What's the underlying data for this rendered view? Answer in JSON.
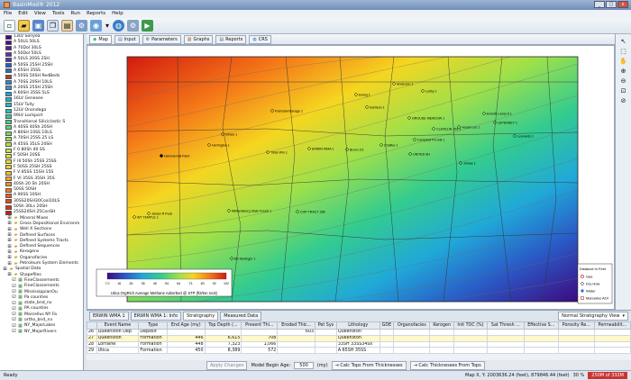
{
  "window": {
    "title": "BasinMod® 2012",
    "controls": [
      "_",
      "□",
      "x"
    ]
  },
  "menu": [
    "File",
    "Edit",
    "View",
    "Tools",
    "Run",
    "Reports",
    "Help"
  ],
  "toolbar": {
    "icons": [
      "new-icon",
      "open-icon",
      "save-icon",
      "copy-icon",
      "paste-icon",
      "settings-icon",
      "map-icon",
      "chevron-down-icon",
      "globe-icon",
      "gear-icon",
      "play-icon"
    ]
  },
  "layers": [
    {
      "label": "13LV Sonyea",
      "color": "#4b0082"
    },
    {
      "label": "A 50LS 50LS",
      "color": "#4d0c8f"
    },
    {
      "label": "A 70Dol 30LS",
      "color": "#5b1aa0"
    },
    {
      "label": "A 50Dol 50LS",
      "color": "#6a2eb5"
    },
    {
      "label": "A 50LS 20SS 2SH",
      "color": "#3b3fb8"
    },
    {
      "label": "A 50SS 25SH 25SH",
      "color": "#2b5ac6"
    },
    {
      "label": "A 65SH 35SS",
      "color": "#2070cf"
    },
    {
      "label": "A 50SS 50SH RedBeds",
      "color": "#b0402a"
    },
    {
      "label": "A 70SS 20SH 10LS",
      "color": "#2a87d4"
    },
    {
      "label": "A 20SS 25SH 25SH",
      "color": "#2b96d8"
    },
    {
      "label": "A 60SH 35SS 5LS",
      "color": "#1fa5dc"
    },
    {
      "label": "16LV Genesee",
      "color": "#19b2d8"
    },
    {
      "label": "15LV Tully",
      "color": "#19bdcc"
    },
    {
      "label": "12LV Onondaga",
      "color": "#1ec6b8"
    },
    {
      "label": "09LV Lockport",
      "color": "#2ccda0"
    },
    {
      "label": "Transitional Siliciclastic S",
      "color": "#40d28a"
    },
    {
      "label": "A 40SS 40Sh 20SH",
      "color": "#5cd676"
    },
    {
      "label": "A 80SH 10SS 10LS",
      "color": "#78da62"
    },
    {
      "label": "A 70SH 25SS 25 LS",
      "color": "#96de50"
    },
    {
      "label": "A 45SS 35LS 20SH",
      "color": "#b1e040"
    },
    {
      "label": "F 0 80Sh 40 SS",
      "color": "#c9e234"
    },
    {
      "label": "F 50SH 20SS",
      "color": "#dde22c"
    },
    {
      "label": "F III 50Sh 25SS 25SS",
      "color": "#eddc26"
    },
    {
      "label": "F 50SS 25SH 25SS",
      "color": "#f6cf22"
    },
    {
      "label": "F V 85SS 15SH 15S",
      "color": "#f9bd20"
    },
    {
      "label": "F VI 35SS 35SH 35S",
      "color": "#fba61e"
    },
    {
      "label": "40Sh 20 Sh 20SH",
      "color": "#fc8e1c"
    },
    {
      "label": "50SS 50SH",
      "color": "#fc751a"
    },
    {
      "label": "A 90SS 10SH",
      "color": "#f85c18"
    },
    {
      "label": "30SS20SH30Coal10LS",
      "color": "#f04416"
    },
    {
      "label": "50Sh 30Ls 20SH",
      "color": "#e02f14"
    },
    {
      "label": "25SS20SH 25ConSH",
      "color": "#c81e12"
    }
  ],
  "tree": [
    {
      "label": "Mineral Mixes",
      "icon": "folder-icon",
      "indent": 1
    },
    {
      "label": "Gross Depositional Environm",
      "icon": "folder-icon",
      "indent": 1
    },
    {
      "label": "Well X Sections",
      "icon": "folder-icon",
      "indent": 1
    },
    {
      "label": "Defined Surfaces",
      "icon": "folder-icon",
      "indent": 1
    },
    {
      "label": "Defined Systems Tracts",
      "icon": "folder-icon",
      "indent": 1
    },
    {
      "label": "Defined Sequences",
      "icon": "folder-icon",
      "indent": 1
    },
    {
      "label": "Kerogens",
      "icon": "folder-icon",
      "indent": 1
    },
    {
      "label": "Organofacies",
      "icon": "folder-icon",
      "indent": 1
    },
    {
      "label": "Petroleum System Elements",
      "icon": "folder-icon",
      "indent": 1
    },
    {
      "label": "Spatial Data",
      "icon": "folder-icon",
      "indent": 0
    },
    {
      "label": "Shapefiles",
      "icon": "folder-icon",
      "indent": 1
    },
    {
      "label": "FineClassements",
      "icon": "layer-icon",
      "indent": 2
    },
    {
      "label": "FineClassements",
      "icon": "layer-icon",
      "indent": 2
    },
    {
      "label": "MississippianOu",
      "icon": "layer-icon",
      "indent": 2
    },
    {
      "label": "Pa counties",
      "icon": "layer-icon",
      "indent": 2
    },
    {
      "label": "state_bnd_nv",
      "icon": "layer-icon",
      "indent": 2
    },
    {
      "label": "PA counties",
      "icon": "layer-icon",
      "indent": 2
    },
    {
      "label": "Marcellus NY Fa",
      "icon": "layer-icon",
      "indent": 2
    },
    {
      "label": "ortho_bnd_nv",
      "icon": "layer-icon",
      "indent": 2
    },
    {
      "label": "NY_MajorLakes",
      "icon": "layer-icon",
      "indent": 2
    },
    {
      "label": "NY_MajorRivers",
      "icon": "layer-icon",
      "indent": 2
    }
  ],
  "tabs": [
    {
      "label": "Map",
      "icon": "map-icon",
      "active": true
    },
    {
      "label": "Input",
      "icon": "input-icon",
      "active": false
    },
    {
      "label": "Parameters",
      "icon": "gear-icon",
      "active": false
    },
    {
      "label": "Graphs",
      "icon": "chart-icon",
      "active": false
    },
    {
      "label": "Reports",
      "icon": "report-icon",
      "active": false
    },
    {
      "label": "CRS",
      "icon": "globe-icon",
      "active": false
    }
  ],
  "map": {
    "wells": [
      {
        "label": "Hammermill Paint"
      },
      {
        "label": "Herrington 1"
      },
      {
        "label": "Dinele 1"
      },
      {
        "label": "Framsdw/Savage 1"
      },
      {
        "label": "Darrison 1"
      },
      {
        "label": "Ewing 1"
      },
      {
        "label": "Anderson 1"
      },
      {
        "label": "Lebby 1"
      },
      {
        "label": "GROUSE MEADOW 1"
      },
      {
        "label": "CLEVELIN 153 1"
      },
      {
        "label": "Hoose Lee 1"
      },
      {
        "label": "Emmitt Lowry 6 1"
      },
      {
        "label": "Tibbs Wln 1"
      },
      {
        "label": "Brenn 2/1"
      },
      {
        "label": "ERWIN WMA 1"
      },
      {
        "label": "Chaffee 1"
      },
      {
        "label": "Campbell Pd unit 1"
      },
      {
        "label": "LEPENSEY 1"
      },
      {
        "label": "UNITED 8H"
      },
      {
        "label": "James R Peck"
      },
      {
        "label": "WT TEMPLE 1"
      },
      {
        "label": "Williamsburg State Forest 1"
      },
      {
        "label": "COP TRACT 285"
      },
      {
        "label": "Jomee 1"
      },
      {
        "label": "Elb Bevinger 1"
      },
      {
        "label": "Leonards 1"
      }
    ],
    "colorbar": {
      "ticks": [
        "7.0",
        "16",
        "26",
        "35",
        "45",
        "54",
        "64",
        "73",
        "83",
        "92",
        "102"
      ],
      "caption": "Utica OrgRich Average Methane Adsorbed @ STP (ft3/ton rock)"
    },
    "legend": {
      "title": "Distance in Feet",
      "items": [
        {
          "label": "Gas",
          "icon": "gas-well-icon"
        },
        {
          "label": "Dry Hole",
          "icon": "dry-hole-icon"
        },
        {
          "label": "Water",
          "icon": "water-well-icon"
        },
        {
          "label": "Marcellus AOI",
          "icon": "aoi-box-icon"
        }
      ]
    }
  },
  "right_tools": [
    "pointer-icon",
    "select-icon",
    "hand-icon",
    "zoom-in-icon",
    "zoom-out-icon",
    "zoom-extent-icon",
    "zoom-prev-icon"
  ],
  "bottom": {
    "tabs": [
      {
        "label": "ERWIN WMA 1",
        "active": false
      },
      {
        "label": "ERWIN WMA 1: Info",
        "active": false
      },
      {
        "label": "Stratigraphy",
        "active": true
      },
      {
        "label": "Measured Data",
        "active": false
      }
    ],
    "view_select": "Normal Stratigraphy View",
    "columns": [
      "",
      "Event Name",
      "Type",
      "End Age (my)",
      "Top Depth (...",
      "Present Thi...",
      "Eroded Thic...",
      "Pet Sys",
      "Lithology",
      "GDE",
      "Organofacies",
      "Kerogen",
      "Init TOC (%)",
      "Sat Thresh ...",
      "Effective S...",
      "Porosity Re...",
      "Permeabilit..."
    ],
    "rows": [
      {
        "n": "26",
        "name": "Queenston Dep",
        "type": "Deposit",
        "age": "",
        "top": "",
        "thick": "",
        "eroded": "603",
        "pet": "",
        "lith": "Queenston",
        "toc": "",
        "sat": "",
        "selected": false
      },
      {
        "n": "27",
        "name": "Queenston",
        "type": "Formation",
        "age": "446",
        "top": "6,615",
        "thick": "708",
        "eroded": "",
        "pet": "",
        "lith": "Queenston",
        "toc": "",
        "sat": "",
        "selected": true
      },
      {
        "n": "28",
        "name": "Lorraine",
        "type": "Formation",
        "age": "448",
        "top": "7,323",
        "thick": "1,066",
        "eroded": "",
        "pet": "",
        "lith": "33SH 33SS34Ss",
        "toc": "",
        "sat": "",
        "selected": false
      },
      {
        "n": "29",
        "name": "Utica",
        "type": "Formation",
        "age": "450",
        "top": "8,389",
        "thick": "572",
        "eroded": "",
        "pet": "",
        "lith": "A 65SH 35SS",
        "toc": "",
        "sat": "",
        "selected": false
      }
    ],
    "apply_button": "Apply Changes",
    "model_begin_label": "Model Begin Age:",
    "model_begin_value": "500",
    "model_begin_unit": "(my)",
    "calc_tops": "Calc Tops From Thicknesses",
    "calc_thick": "Calc Thicknesses From Tops"
  },
  "status": {
    "left": "Ready",
    "coords": "Map X, Y: 2003636.24 (feet), 879846.44 (feet)",
    "zoom": "30 %",
    "memory": "250M of 332M"
  }
}
